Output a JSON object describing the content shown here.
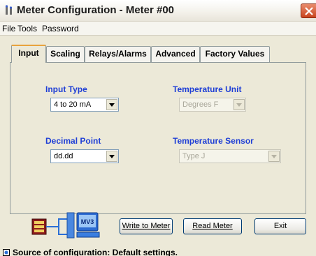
{
  "window": {
    "title": "Meter Configuration - Meter #00"
  },
  "menu": {
    "items": [
      "File",
      "Tools",
      "Password"
    ]
  },
  "tabs": [
    "Input",
    "Scaling",
    "Relays/Alarms",
    "Advanced",
    "Factory Values"
  ],
  "active_tab": "Input",
  "form": {
    "input_type": {
      "label": "Input Type",
      "value": "4 to 20 mA"
    },
    "decimal_point": {
      "label": "Decimal Point",
      "value": "dd.dd"
    },
    "temperature_unit": {
      "label": "Temperature Unit",
      "value": "Degrees F"
    },
    "temperature_sensor": {
      "label": "Temperature Sensor",
      "value": "Type J"
    }
  },
  "graphic": {
    "screen_text": "MV3"
  },
  "buttons": {
    "write": "Write to Meter",
    "read": "Read Meter",
    "exit": "Exit"
  },
  "status": {
    "text": "Source of configuration: Default settings."
  },
  "colors": {
    "label_blue": "#1f3fd6",
    "close_red": "#c9441f",
    "tab_highlight": "#e8a33c"
  }
}
